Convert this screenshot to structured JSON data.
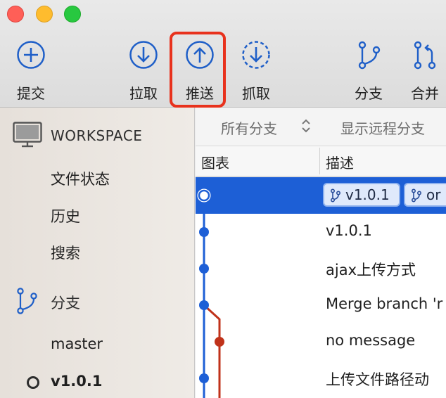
{
  "window": {
    "controls": [
      "close",
      "minimize",
      "zoom"
    ]
  },
  "toolbar": {
    "commit_label": "提交",
    "pull_label": "拉取",
    "push_label": "推送",
    "fetch_label": "抓取",
    "branch_label": "分支",
    "merge_label": "合并",
    "highlight_color": "#e8321d"
  },
  "sidebar": {
    "workspace_title": "WORKSPACE",
    "workspace_items": [
      "文件状态",
      "历史",
      "搜索"
    ],
    "branches_title": "分支",
    "branches": [
      "master",
      "v1.0.1"
    ],
    "current_branch": "v1.0.1"
  },
  "filter": {
    "all_branches": "所有分支",
    "show_remote": "显示远程分支"
  },
  "columns": {
    "graph": "图表",
    "description": "描述"
  },
  "commits": [
    {
      "tags": [
        "v1.0.1",
        "or"
      ],
      "selected": true
    },
    {
      "description": "v1.0.1"
    },
    {
      "description": "ajax上传方式"
    },
    {
      "description": "Merge branch 'r"
    },
    {
      "description": "no message"
    },
    {
      "description": "上传文件路径动"
    }
  ],
  "colors": {
    "selection": "#1d5fd6",
    "graph_main": "#1d5fd6",
    "graph_branch": "#c0321a",
    "accent": "#1f5fc8"
  }
}
